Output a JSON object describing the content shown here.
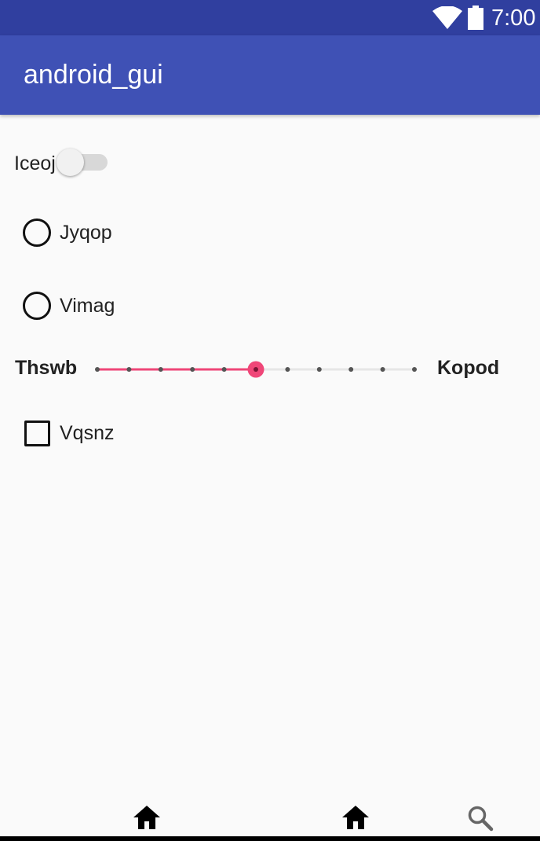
{
  "status_bar": {
    "time": "7:00",
    "icons": [
      "wifi-icon",
      "battery-icon"
    ]
  },
  "app_bar": {
    "title": "android_gui"
  },
  "switch": {
    "label": "Iceoj",
    "checked": false
  },
  "radios": [
    {
      "label": "Jyqop",
      "selected": false
    },
    {
      "label": "Vimag",
      "selected": false
    }
  ],
  "slider": {
    "left_label": "Thswb",
    "right_label": "Kopod",
    "steps": 10,
    "value": 5
  },
  "checkbox": {
    "label": "Vqsnz",
    "checked": false
  },
  "bottom_nav": {
    "icons": [
      "home-icon",
      "home-icon",
      "search-icon"
    ]
  },
  "colors": {
    "status_bar": "#303f9f",
    "app_bar": "#3f51b5",
    "accent": "#ef4678",
    "background": "#fafafa"
  }
}
